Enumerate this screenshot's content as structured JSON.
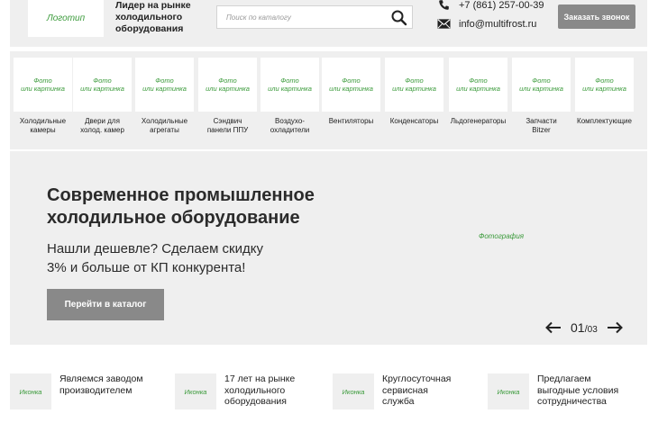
{
  "header": {
    "logo": "Логотип",
    "tagline": "Лидер на рынке холодильного оборудования",
    "search_placeholder": "Поиск по каталогу",
    "phone": "+7 (861) 257-00-39",
    "email": "info@multifrost.ru",
    "callback_label": "Заказать звонок"
  },
  "categories": [
    {
      "thumb": "Фото\nили картинка",
      "label": "Холодильные\nкамеры"
    },
    {
      "thumb": "Фото\nили картинка",
      "label": "Двери для\nхолод. камер"
    },
    {
      "thumb": "Фото\nили картинка",
      "label": "Холодильные\nагрегаты"
    },
    {
      "thumb": "Фото\nили картинка",
      "label": "Сэндвич\nпанели ППУ"
    },
    {
      "thumb": "Фото\nили картинка",
      "label": "Воздухо-\nохладители"
    },
    {
      "thumb": "Фото\nили картинка",
      "label": "Вентиляторы"
    },
    {
      "thumb": "Фото\nили картинка",
      "label": "Конденсаторы"
    },
    {
      "thumb": "Фото\nили картинка",
      "label": "Льдогенераторы"
    },
    {
      "thumb": "Фото\nили картинка",
      "label": "Запчасти\nBitzer"
    },
    {
      "thumb": "Фото\nили картинка",
      "label": "Комплектующие"
    }
  ],
  "hero": {
    "title": "Современное промышленное\nхолодильное оборудование",
    "subtitle": "Нашли дешевле? Сделаем скидку\n3% и больше от КП конкурента!",
    "button_label": "Перейти в каталог",
    "photo_label": "Фотография",
    "slide_current": "01",
    "slide_separator": "/",
    "slide_total": "03"
  },
  "features": [
    {
      "icon": "Иконка",
      "text": "Являемся заводом\nпроизводителем"
    },
    {
      "icon": "Иконка",
      "text": "17 лет на рынке\nхолодильного\nоборудования"
    },
    {
      "icon": "Иконка",
      "text": "Круглосуточная\nсервисная\nслужба"
    },
    {
      "icon": "Иконка",
      "text": "Предлагаем\nвыгодные условия\nсотрудничества"
    }
  ],
  "colors": {
    "panel_bg": "#efefef",
    "button_bg": "#898989",
    "placeholder_green": "#3a9a3a"
  }
}
